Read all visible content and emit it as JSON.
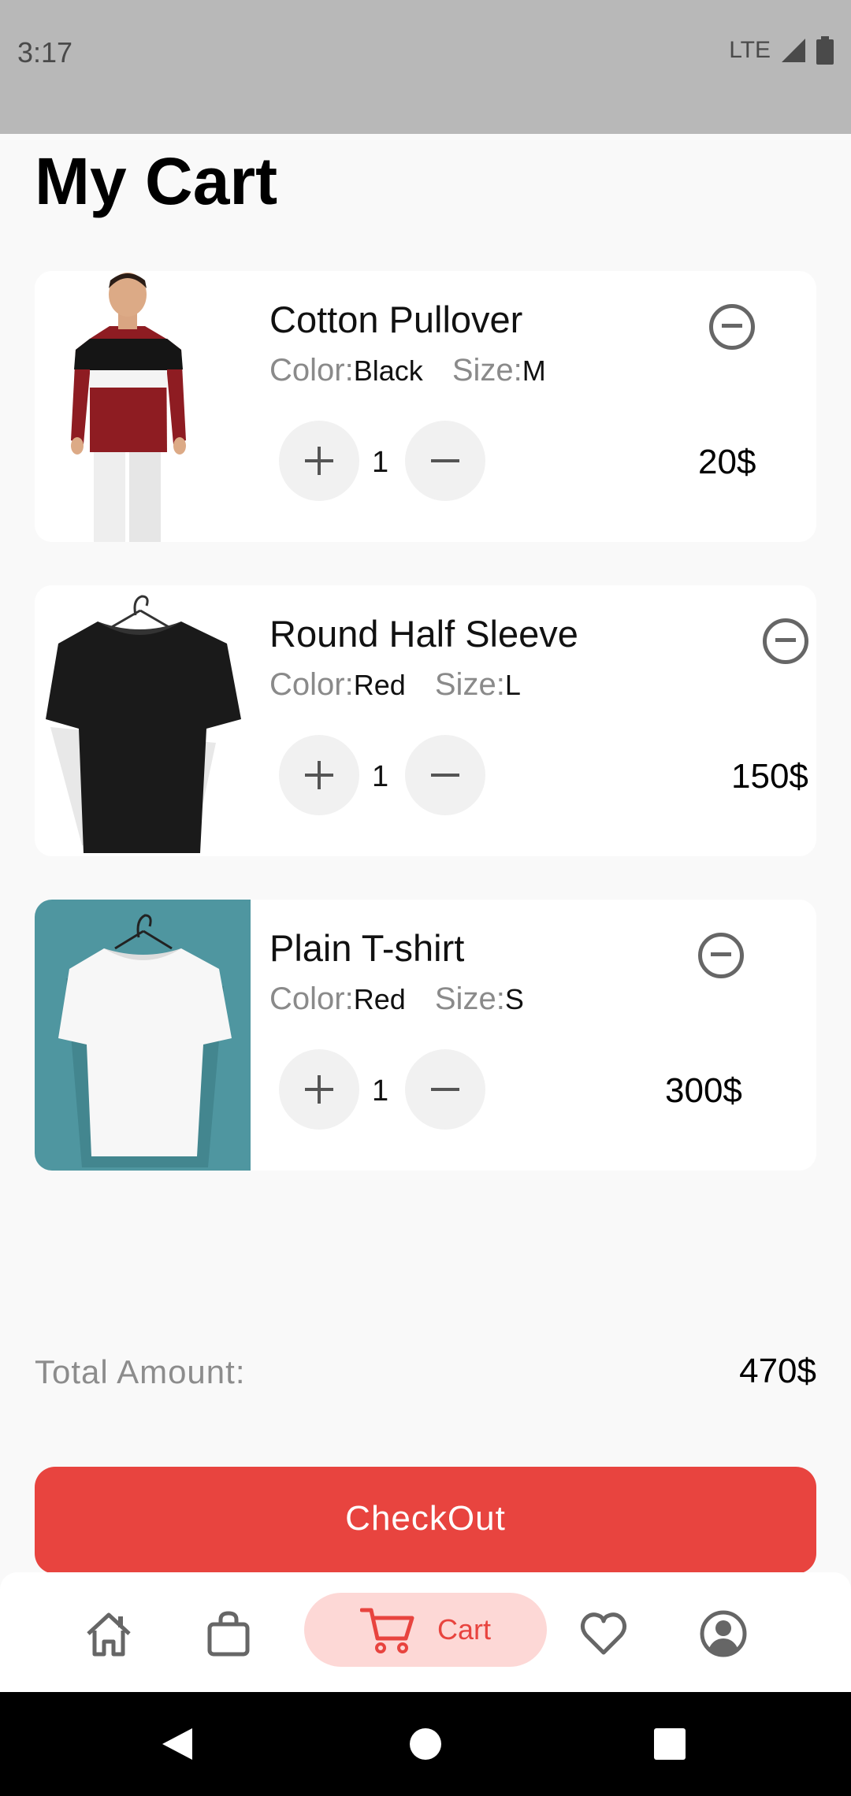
{
  "status": {
    "time": "3:17",
    "network": "LTE"
  },
  "page": {
    "title": "My Cart"
  },
  "labels": {
    "color": "Color:",
    "size": "Size:"
  },
  "items": [
    {
      "name": "Cotton Pullover",
      "color": "Black",
      "size": "M",
      "quantity": "1",
      "price": "20$"
    },
    {
      "name": "Round Half Sleeve",
      "color": "Red",
      "size": "L",
      "quantity": "1",
      "price": "150$"
    },
    {
      "name": "Plain T-shirt",
      "color": "Red",
      "size": "S",
      "quantity": "1",
      "price": "300$"
    }
  ],
  "summary": {
    "total_label": "Total Amount:",
    "total_value": "470$"
  },
  "checkout": {
    "label": "CheckOut"
  },
  "bottom_nav": {
    "items": [
      {
        "icon": "home-icon"
      },
      {
        "icon": "bag-icon"
      },
      {
        "icon": "cart-icon",
        "label": "Cart",
        "active": true
      },
      {
        "icon": "heart-icon"
      },
      {
        "icon": "profile-icon"
      }
    ]
  },
  "colors": {
    "accent": "#e8443f",
    "accent_light": "#fdd8d6",
    "background": "#f9f9f9",
    "status_bar": "#b8b8b8"
  }
}
